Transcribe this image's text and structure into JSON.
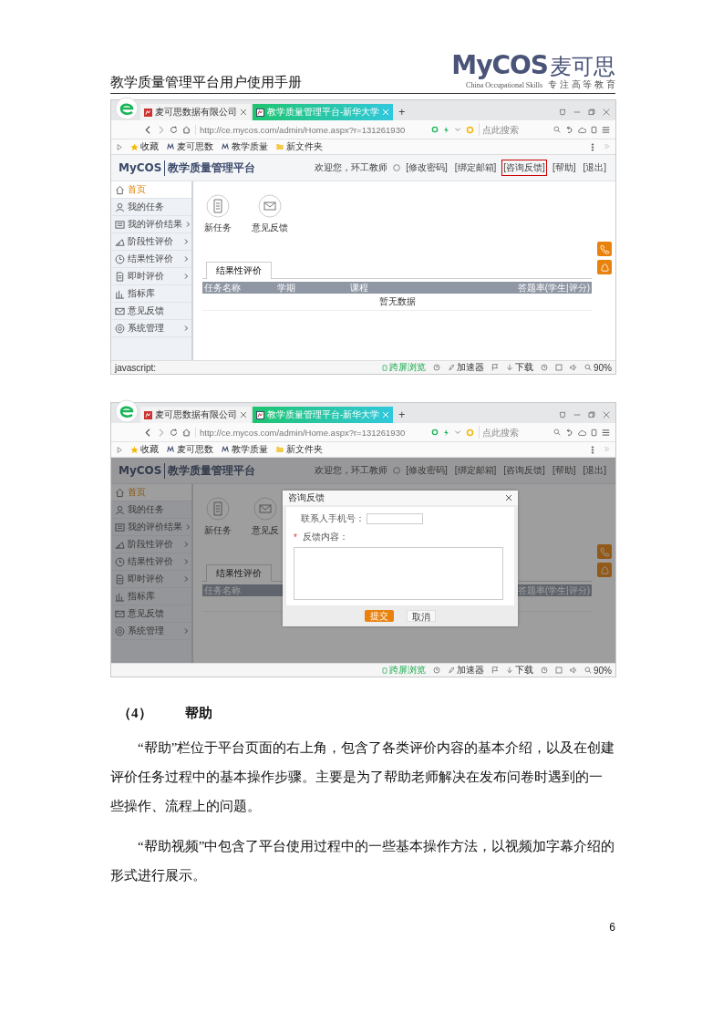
{
  "document": {
    "title": "教学质量管理平台用户使用手册",
    "logo": {
      "brand": "MyCOS",
      "name": "麦可思",
      "tagline": "China Occupational Skills",
      "slogan": "专 注 高 等 教 育"
    }
  },
  "screenshots": [
    {
      "browser": {
        "tabs": [
          {
            "title": "麦可思数据有限公司",
            "selected": false
          },
          {
            "title": "教学质量管理平台-新华大学",
            "selected": true
          }
        ],
        "new_tab": "+",
        "url": "http://ce.mycos.com/admin/Home.aspx?r=131261930",
        "search_placeholder": "点此搜索",
        "bookmarks": [
          "收藏",
          "麦可思数",
          "教学质量",
          "新文件夹"
        ],
        "status_text": "javascript:",
        "status_items": [
          "跨屏浏览",
          "加速器",
          "下载",
          "90%"
        ]
      },
      "app": {
        "logo": "MyCOS",
        "title": "教学质量管理平台",
        "welcome": "欢迎您，环工教师",
        "links": [
          {
            "label": "[修改密码]",
            "highlighted": false
          },
          {
            "label": "[绑定邮箱]",
            "highlighted": false
          },
          {
            "label": "[咨询反馈]",
            "highlighted": true
          },
          {
            "label": "[帮助]",
            "highlighted": false
          },
          {
            "label": "[退出]",
            "highlighted": false
          }
        ],
        "menu": [
          {
            "label": "首页",
            "selected": true,
            "expandable": false
          },
          {
            "label": "我的任务",
            "selected": false,
            "expandable": false
          },
          {
            "label": "我的评价结果",
            "selected": false,
            "expandable": true
          },
          {
            "label": "阶段性评价",
            "selected": false,
            "expandable": true
          },
          {
            "label": "结果性评价",
            "selected": false,
            "expandable": true
          },
          {
            "label": "即时评价",
            "selected": false,
            "expandable": true
          },
          {
            "label": "指标库",
            "selected": false,
            "expandable": false
          },
          {
            "label": "意见反馈",
            "selected": false,
            "expandable": false
          },
          {
            "label": "系统管理",
            "selected": false,
            "expandable": true
          }
        ],
        "shortcuts": [
          "新任务",
          "意见反馈"
        ],
        "result_tab": "结果性评价",
        "columns": [
          "任务名称",
          "学期",
          "课程",
          "答题率(学生|评分)"
        ],
        "empty_text": "暂无数据"
      },
      "dimmed": false
    },
    {
      "browser": {
        "tabs": [
          {
            "title": "麦可思数据有限公司",
            "selected": false
          },
          {
            "title": "教学质量管理平台-新华大学",
            "selected": true
          }
        ],
        "new_tab": "+",
        "url": "http://ce.mycos.com/admin/Home.aspx?r=131261930",
        "search_placeholder": "点此搜索",
        "bookmarks": [
          "收藏",
          "麦可思数",
          "教学质量",
          "新文件夹"
        ],
        "status_items": [
          "跨屏浏览",
          "加速器",
          "下载",
          "90%"
        ]
      },
      "app": {
        "logo": "MyCOS",
        "title": "教学质量管理平台",
        "welcome": "欢迎您，环工教师",
        "links": [
          {
            "label": "[修改密码]",
            "highlighted": false
          },
          {
            "label": "[绑定邮箱]",
            "highlighted": false
          },
          {
            "label": "[咨询反馈]",
            "highlighted": false
          },
          {
            "label": "[帮助]",
            "highlighted": false
          },
          {
            "label": "[退出]",
            "highlighted": false
          }
        ],
        "menu": [
          {
            "label": "首页",
            "selected": true,
            "expandable": false
          },
          {
            "label": "我的任务",
            "selected": false,
            "expandable": false
          },
          {
            "label": "我的评价结果",
            "selected": false,
            "expandable": true
          },
          {
            "label": "阶段性评价",
            "selected": false,
            "expandable": true
          },
          {
            "label": "结果性评价",
            "selected": false,
            "expandable": true
          },
          {
            "label": "即时评价",
            "selected": false,
            "expandable": true
          },
          {
            "label": "指标库",
            "selected": false,
            "expandable": false
          },
          {
            "label": "意见反馈",
            "selected": false,
            "expandable": false
          },
          {
            "label": "系统管理",
            "selected": false,
            "expandable": true
          }
        ],
        "shortcuts": [
          "新任务",
          "意见反"
        ],
        "result_tab": "结果性评价",
        "columns": [
          "任务名称",
          "答题率(学生|评分)"
        ]
      },
      "dimmed": true,
      "dialog": {
        "title": "咨询反馈",
        "phone_label": "联系人手机号：",
        "required_mark": "*",
        "content_label": "反馈内容：",
        "submit": "提交",
        "cancel": "取消"
      }
    }
  ],
  "section": {
    "number": "（4）",
    "title": "帮助"
  },
  "paragraphs": [
    "“帮助”栏位于平台页面的右上角，包含了各类评价内容的基本介绍，以及在创建评价任务过程中的基本操作步骤。主要是为了帮助老师解决在发布问卷时遇到的一些操作、流程上的问题。",
    "“帮助视频”中包含了平台使用过程中的一些基本操作方法，以视频加字幕介绍的形式进行展示。"
  ],
  "page_number": "6"
}
